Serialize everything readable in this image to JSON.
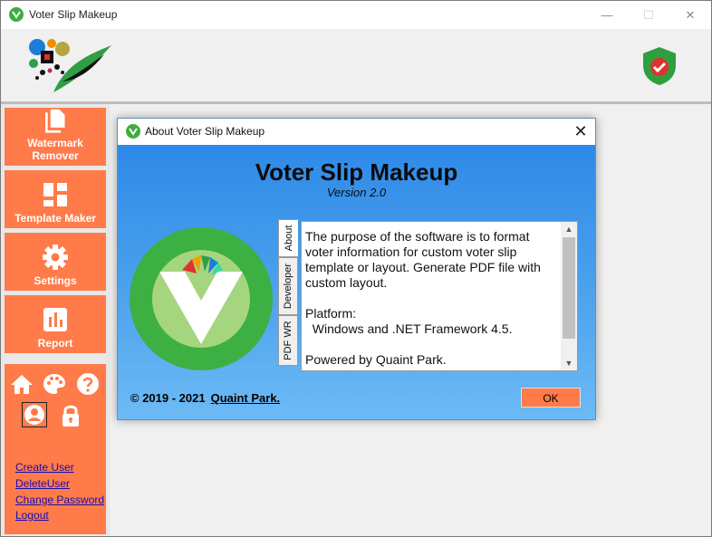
{
  "window": {
    "title": "Voter Slip Makeup",
    "minimize": "—",
    "maximize": "☐",
    "close": "✕"
  },
  "sidebar": {
    "items": [
      {
        "label": "Watermark Remover",
        "icon": "document-copy-icon"
      },
      {
        "label": "Template Maker",
        "icon": "grid-layout-icon"
      },
      {
        "label": "Settings",
        "icon": "gear-icon"
      },
      {
        "label": "Report",
        "icon": "bar-chart-icon"
      }
    ],
    "quick_icons": [
      "home-icon",
      "palette-icon",
      "help-icon",
      "user-icon",
      "lock-icon"
    ],
    "links": [
      "Create User",
      "DeleteUser",
      "Change Password",
      "Logout"
    ]
  },
  "dialog": {
    "title": "About Voter Slip Makeup",
    "close": "✕",
    "app_name": "Voter Slip Makeup",
    "version": "Version 2.0",
    "tabs": [
      "About",
      "Developer",
      "PDF WR"
    ],
    "about_paragraphs": [
      "The purpose of the software is to format voter information for custom voter slip template or layout. Generate PDF file with custom layout.",
      "Platform:\n  Windows and .NET Framework 4.5.",
      "Powered by Quaint Park."
    ],
    "copyright": "© 2019 - 2021",
    "company": "Quaint Park.",
    "ok_label": "OK"
  },
  "colors": {
    "accent": "#ff7b4a",
    "dialog_gradient_top": "#2e8ae8",
    "dialog_gradient_bottom": "#6dbaf5",
    "logo_green": "#3cae3c",
    "shield_green": "#2e9e3e"
  }
}
